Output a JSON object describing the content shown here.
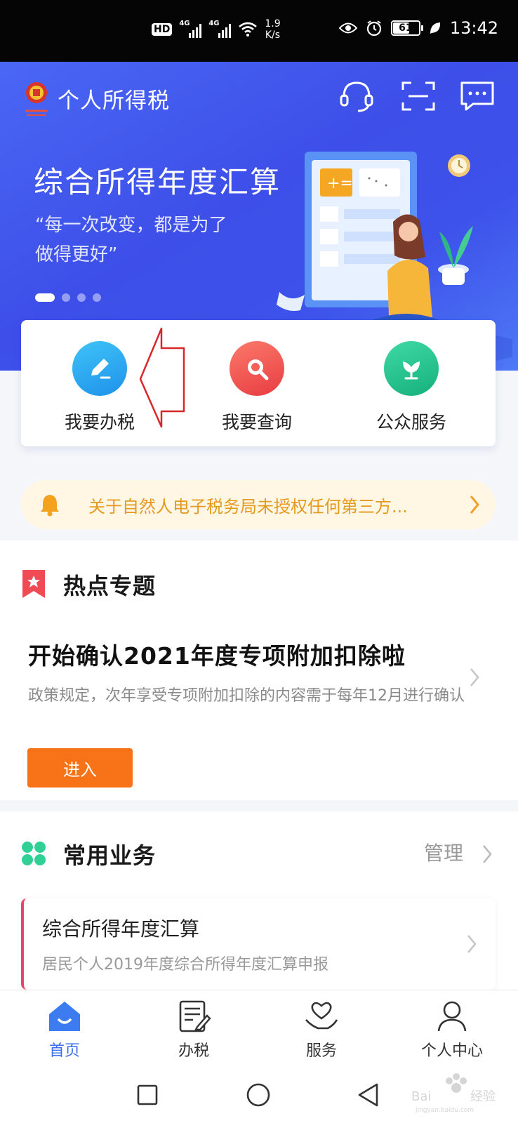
{
  "status_bar": {
    "hd_label": "HD",
    "net1": "4G",
    "net2": "4G",
    "speed_value": "1.9",
    "speed_unit": "K/s",
    "battery": "61",
    "battery_level": 0.61,
    "time": "13:42"
  },
  "header": {
    "app_title": "个人所得税"
  },
  "banner": {
    "title": "综合所得年度汇算",
    "subtitle_line1": "“每一次改变，都是为了",
    "subtitle_line2": "做得更好”",
    "active_index": 0
  },
  "quick_actions": [
    {
      "label": "我要办税",
      "color": "#27a8f0"
    },
    {
      "label": "我要查询",
      "color": "#f0544e"
    },
    {
      "label": "公众服务",
      "color": "#21c38e"
    }
  ],
  "notice": {
    "text": "关于自然人电子税务局未授权任何第三方..."
  },
  "hot_topics": {
    "section_title": "热点专题",
    "title": "开始确认2021年度专项附加扣除啦",
    "desc": "政策规定，次年享受专项附加扣除的内容需于每年12月进行确认",
    "button": "进入"
  },
  "common_business": {
    "section_title": "常用业务",
    "manage": "管理",
    "items": [
      {
        "title": "综合所得年度汇算",
        "sub": "居民个人2019年度综合所得年度汇算申报"
      }
    ]
  },
  "bottom_nav": [
    {
      "label": "首页",
      "active": true
    },
    {
      "label": "办税"
    },
    {
      "label": "服务"
    },
    {
      "label": "个人中心"
    }
  ],
  "colors": {
    "brand_blue": "#3d52ea",
    "accent_orange": "#f87317",
    "notice_text": "#e49a1e"
  }
}
